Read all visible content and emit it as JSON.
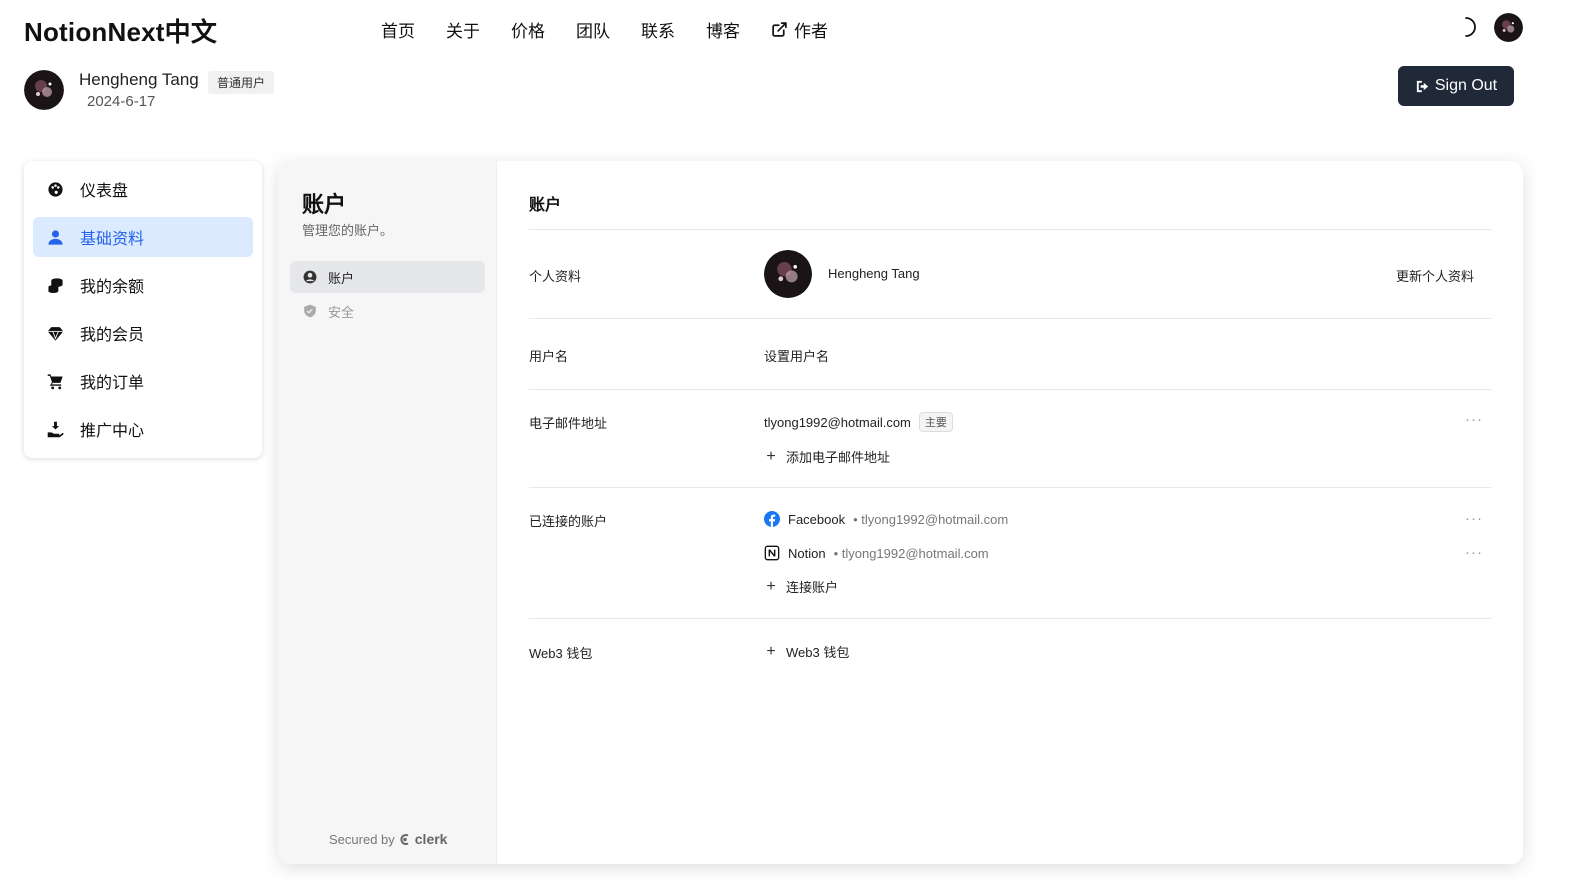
{
  "header": {
    "brand": "NotionNext中文",
    "nav": [
      "首页",
      "关于",
      "价格",
      "团队",
      "联系",
      "博客",
      "作者"
    ]
  },
  "profile": {
    "name": "Hengheng Tang",
    "badge": "普通用户",
    "date": "2024-6-17",
    "signout_label": "Sign Out"
  },
  "leftmenu": {
    "items": [
      {
        "label": "仪表盘",
        "icon": "palette-icon"
      },
      {
        "label": "基础资料",
        "icon": "user-icon"
      },
      {
        "label": "我的余额",
        "icon": "coins-icon"
      },
      {
        "label": "我的会员",
        "icon": "gem-icon"
      },
      {
        "label": "我的订单",
        "icon": "cart-icon"
      },
      {
        "label": "推广中心",
        "icon": "hand-coin-icon"
      }
    ],
    "active_index": 1
  },
  "clerk": {
    "side": {
      "title": "账户",
      "subtitle": "管理您的账户。",
      "items": [
        "账户",
        "安全"
      ],
      "secured_prefix": "Secured by",
      "secured_brand": "clerk"
    },
    "main": {
      "title": "账户",
      "profile_label": "个人资料",
      "profile_name": "Hengheng Tang",
      "update_profile": "更新个人资料",
      "username_label": "用户名",
      "username_action": "设置用户名",
      "email_label": "电子邮件地址",
      "email": "tlyong1992@hotmail.com",
      "email_tag": "主要",
      "add_email": "添加电子邮件地址",
      "connected_label": "已连接的账户",
      "connected": [
        {
          "provider": "Facebook",
          "email": "• tlyong1992@hotmail.com"
        },
        {
          "provider": "Notion",
          "email": "• tlyong1992@hotmail.com"
        }
      ],
      "connect_account": "连接账户",
      "web3_label": "Web3 钱包",
      "web3_action": "Web3 钱包"
    }
  },
  "colors": {
    "primary": "#2563eb",
    "active_bg": "#dbeafe",
    "button_dark": "#1f2937",
    "facebook": "#1877f2"
  }
}
